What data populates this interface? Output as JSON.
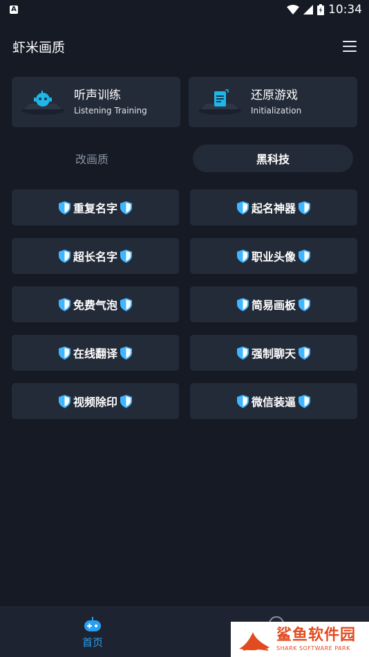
{
  "status_bar": {
    "notification_icon": "a-notification-icon",
    "notification_letter": "A",
    "time": "10:34",
    "icons": [
      "wifi-icon",
      "signal-icon",
      "battery-icon"
    ]
  },
  "app_bar": {
    "title": "虾米画质",
    "menu_icon": "hamburger-menu-icon"
  },
  "feature_cards": [
    {
      "title": "听声训练",
      "subtitle": "Listening Training",
      "icon": "robot-icon"
    },
    {
      "title": "还原游戏",
      "subtitle": "Initialization",
      "icon": "document-icon"
    }
  ],
  "tabs": [
    {
      "label": "改画质",
      "active": false
    },
    {
      "label": "黑科技",
      "active": true
    }
  ],
  "grid_buttons": [
    {
      "label": "重复名字"
    },
    {
      "label": "起名神器"
    },
    {
      "label": "超长名字"
    },
    {
      "label": "职业头像"
    },
    {
      "label": "免费气泡"
    },
    {
      "label": "简易画板"
    },
    {
      "label": "在线翻译"
    },
    {
      "label": "强制聊天"
    },
    {
      "label": "视频除印"
    },
    {
      "label": "微信装逼"
    }
  ],
  "bottom_nav": {
    "items": [
      {
        "label": "首页",
        "icon": "gamepad-icon",
        "active": true
      },
      {
        "label": "",
        "icon": "compass-icon",
        "active": false
      }
    ]
  },
  "watermark": {
    "main": "鲨鱼软件园",
    "sub": "SHARK SOFTWARE PARK"
  },
  "colors": {
    "background": "#151a25",
    "card": "#242b38",
    "accent": "#2a9ff0",
    "shield": "#3fb6ff",
    "watermark": "#e24a1f"
  }
}
